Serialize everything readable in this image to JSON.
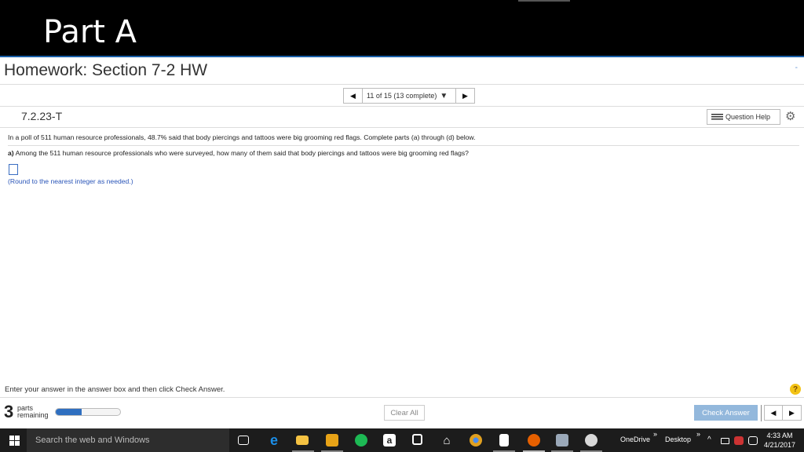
{
  "banner": {
    "title": "Part A"
  },
  "header": {
    "title": "Homework: Section 7-2 HW",
    "dash": "-"
  },
  "nav": {
    "position": "11 of 15 (13 complete)"
  },
  "question": {
    "id": "7.2.23-T",
    "help_label": "Question Help",
    "stem": "In a poll of 511 human resource professionals, 48.7% said that body piercings and tattoos were big grooming red flags. Complete parts (a) through (d) below.",
    "part_a_label": "a)",
    "part_a_text": "Among the 511 human resource professionals who were surveyed, how many of them said that body piercings and tattoos were big grooming red flags?",
    "answer_value": "",
    "hint": "(Round to the nearest integer as needed.)"
  },
  "footer": {
    "instructions": "Enter your answer in the answer box and then click Check Answer.",
    "help": "?",
    "parts_count": "3",
    "parts_line1": "parts",
    "parts_line2": "remaining",
    "progress_fraction": 0.4,
    "clear_all": "Clear All",
    "check_answer": "Check Answer"
  },
  "taskbar": {
    "search_placeholder": "Search the web and Windows",
    "onedrive": "OneDrive",
    "desktop": "Desktop",
    "chevron1": "»",
    "chevron2": "»",
    "time": "4:33 AM",
    "date": "4/21/2017",
    "icons": [
      "task-view-icon",
      "edge-icon",
      "file-explorer-icon",
      "app-icon",
      "spotify-icon",
      "amazon-icon",
      "store-icon",
      "home-icon",
      "chrome-icon",
      "document-icon",
      "firefox-icon",
      "notes-icon",
      "paint-icon"
    ],
    "colors": {
      "edge": "#1b8ee8",
      "explorer": "#f5c242",
      "orange": "#e8a317",
      "spotify": "#1db954",
      "chrome": "#e0a020",
      "firefox": "#e66000"
    }
  }
}
